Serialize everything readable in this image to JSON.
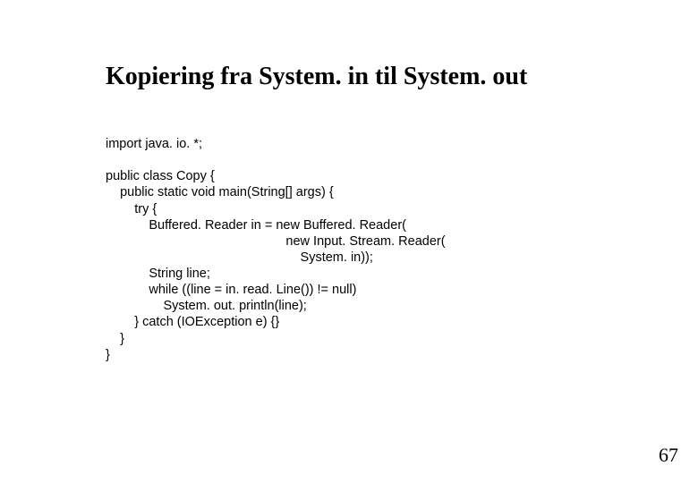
{
  "title": "Kopiering fra System. in til System. out",
  "code": "import java. io. *;\n\npublic class Copy {\n    public static void main(String[] args) {\n        try {\n            Buffered. Reader in = new Buffered. Reader(\n                                                  new Input. Stream. Reader(\n                                                      System. in));\n            String line;\n            while ((line = in. read. Line()) != null)\n                System. out. println(line);\n        } catch (IOException e) {}\n    }\n}",
  "page_number": "67"
}
